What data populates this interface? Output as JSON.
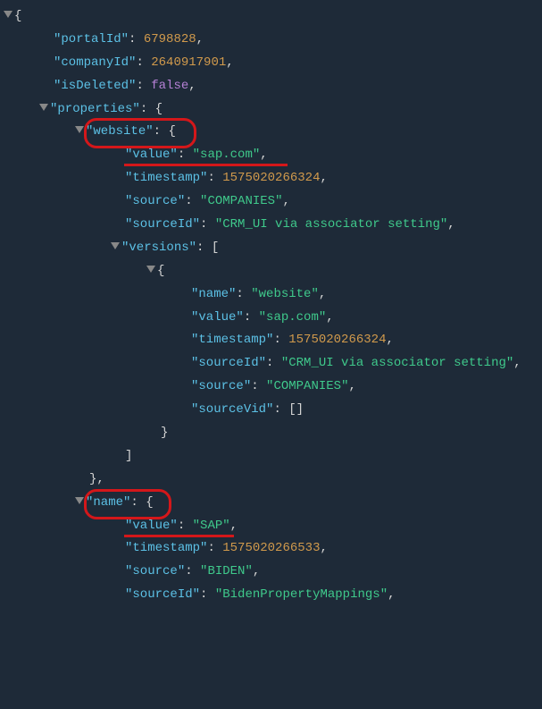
{
  "root": {
    "portalId_key": "portalId",
    "portalId_val": "6798828",
    "companyId_key": "companyId",
    "companyId_val": "2640917901",
    "isDeleted_key": "isDeleted",
    "isDeleted_val": "false",
    "properties_key": "properties",
    "website_key": "website",
    "website": {
      "value_key": "value",
      "value_val": "sap.com",
      "timestamp_key": "timestamp",
      "timestamp_val": "1575020266324",
      "source_key": "source",
      "source_val": "COMPANIES",
      "sourceId_key": "sourceId",
      "sourceId_val": "CRM_UI via associator setting",
      "versions_key": "versions",
      "ver": {
        "name_key": "name",
        "name_val": "website",
        "value_key": "value",
        "value_val": "sap.com",
        "timestamp_key": "timestamp",
        "timestamp_val": "1575020266324",
        "sourceId_key": "sourceId",
        "sourceId_val": "CRM_UI via associator setting",
        "source_key": "source",
        "source_val": "COMPANIES",
        "sourceVid_key": "sourceVid"
      }
    },
    "name_key": "name",
    "name": {
      "value_key": "value",
      "value_val": "SAP",
      "timestamp_key": "timestamp",
      "timestamp_val": "1575020266533",
      "source_key": "source",
      "source_val": "BIDEN",
      "sourceId_key": "sourceId",
      "sourceId_val": "BidenPropertyMappings"
    }
  }
}
